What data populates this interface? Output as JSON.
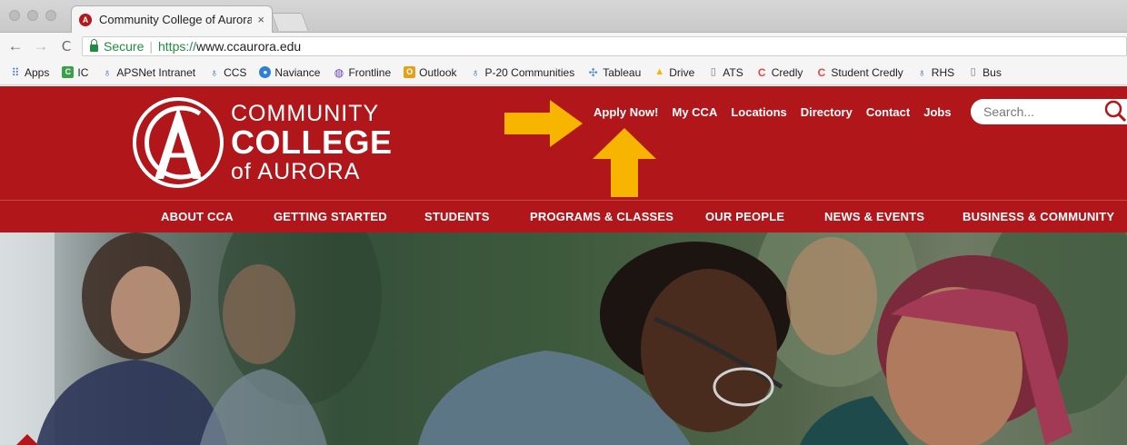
{
  "browser": {
    "tab_title": "Community College of Aurora",
    "tab_close": "×",
    "secure_label": "Secure",
    "url_scheme": "https://",
    "url_host": "www.ccaurora.edu",
    "nav_back": "←",
    "nav_forward": "→",
    "nav_reload": "C"
  },
  "bookmarks": [
    {
      "label": "Apps",
      "icon": "apps-grid-icon",
      "glyph": "⠿"
    },
    {
      "label": "IC",
      "icon": "ic-icon",
      "glyph": "C"
    },
    {
      "label": "APSNet Intranet",
      "icon": "aps-icon",
      "glyph": "♁"
    },
    {
      "label": "CCS",
      "icon": "aps-icon",
      "glyph": "♁"
    },
    {
      "label": "Naviance",
      "icon": "naviance-icon",
      "glyph": "●"
    },
    {
      "label": "Frontline",
      "icon": "frontline-icon",
      "glyph": "◍"
    },
    {
      "label": "Outlook",
      "icon": "outlook-icon",
      "glyph": "O"
    },
    {
      "label": "P-20 Communities",
      "icon": "aps-icon",
      "glyph": "♁"
    },
    {
      "label": "Tableau",
      "icon": "tableau-icon",
      "glyph": "✣"
    },
    {
      "label": "Drive",
      "icon": "drive-icon",
      "glyph": "▲"
    },
    {
      "label": "ATS",
      "icon": "page-icon",
      "glyph": "▯"
    },
    {
      "label": "Credly",
      "icon": "credly-icon",
      "glyph": "C"
    },
    {
      "label": "Student Credly",
      "icon": "credly-icon",
      "glyph": "C"
    },
    {
      "label": "RHS",
      "icon": "aps-icon",
      "glyph": "♁"
    },
    {
      "label": "Bus",
      "icon": "page-icon",
      "glyph": "▯"
    }
  ],
  "logo": {
    "line1": "COMMUNITY",
    "line2": "COLLEGE",
    "line3": "of AURORA"
  },
  "utility_nav": [
    "Apply Now!",
    "My CCA",
    "Locations",
    "Directory",
    "Contact",
    "Jobs"
  ],
  "search": {
    "placeholder": "Search..."
  },
  "main_nav": [
    "ABOUT CCA",
    "GETTING STARTED",
    "STUDENTS",
    "PROGRAMS & CLASSES",
    "OUR PEOPLE",
    "NEWS & EVENTS",
    "BUSINESS & COMMUNITY"
  ],
  "colors": {
    "brand_red": "#b1161b",
    "arrow_yellow": "#f7b500",
    "secure_green": "#1e8e3e"
  }
}
